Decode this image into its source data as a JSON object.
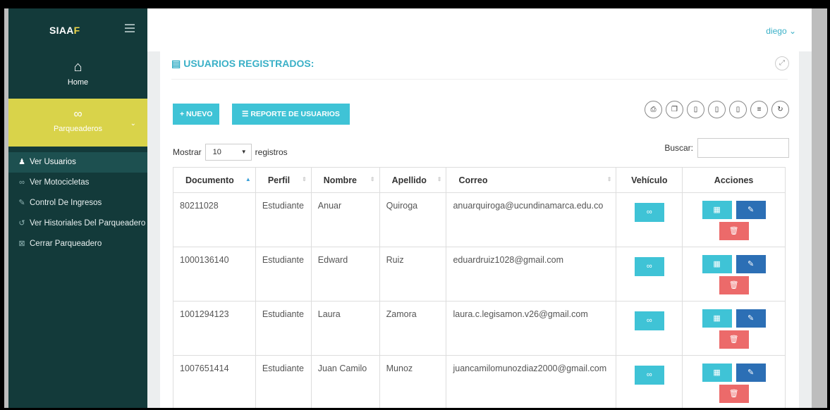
{
  "brand": {
    "text_main": "SIAA",
    "text_accent": "F"
  },
  "topbar": {
    "user": "diego ⌄"
  },
  "sidebar": {
    "home_label": "Home",
    "parking_label": "Parqueaderos",
    "items": [
      {
        "icon": "♟",
        "label": "Ver Usuarios"
      },
      {
        "icon": "∞",
        "label": "Ver Motocicletas"
      },
      {
        "icon": "✎",
        "label": "Control De Ingresos"
      },
      {
        "icon": "↺",
        "label": "Ver Historiales Del Parqueadero"
      },
      {
        "icon": "⊠",
        "label": "Cerrar Parqueadero"
      }
    ]
  },
  "panel": {
    "title": "USUARIOS REGISTRADOS:",
    "new_button": "+ NUEVO",
    "report_button": "☰ REPORTE DE USUARIOS",
    "show_label": "Mostrar",
    "page_size": "10",
    "records_label": "registros",
    "search_label": "Buscar:",
    "search_value": ""
  },
  "table": {
    "headers": [
      "Documento",
      "Perfil",
      "Nombre",
      "Apellido",
      "Correo",
      "Vehículo",
      "Acciones"
    ],
    "rows": [
      {
        "documento": "80211028",
        "perfil": "Estudiante",
        "nombre": "Anuar",
        "apellido": "Quiroga",
        "correo": "anuarquiroga@ucundinamarca.edu.co"
      },
      {
        "documento": "1000136140",
        "perfil": "Estudiante",
        "nombre": "Edward",
        "apellido": "Ruiz",
        "correo": "eduardruiz1028@gmail.com"
      },
      {
        "documento": "1001294123",
        "perfil": "Estudiante",
        "nombre": "Laura",
        "apellido": "Zamora",
        "correo": "laura.c.legisamon.v26@gmail.com"
      },
      {
        "documento": "1007651414",
        "perfil": "Estudiante",
        "nombre": "Juan Camilo",
        "apellido": "Munoz",
        "correo": "juancamilomunozdiaz2000@gmail.com"
      }
    ]
  },
  "colors": {
    "sidebar": "#133a3a",
    "accent": "#3fc3d6",
    "active": "#d9d34a",
    "danger": "#ec6a6a",
    "edit": "#2c6fb5"
  }
}
